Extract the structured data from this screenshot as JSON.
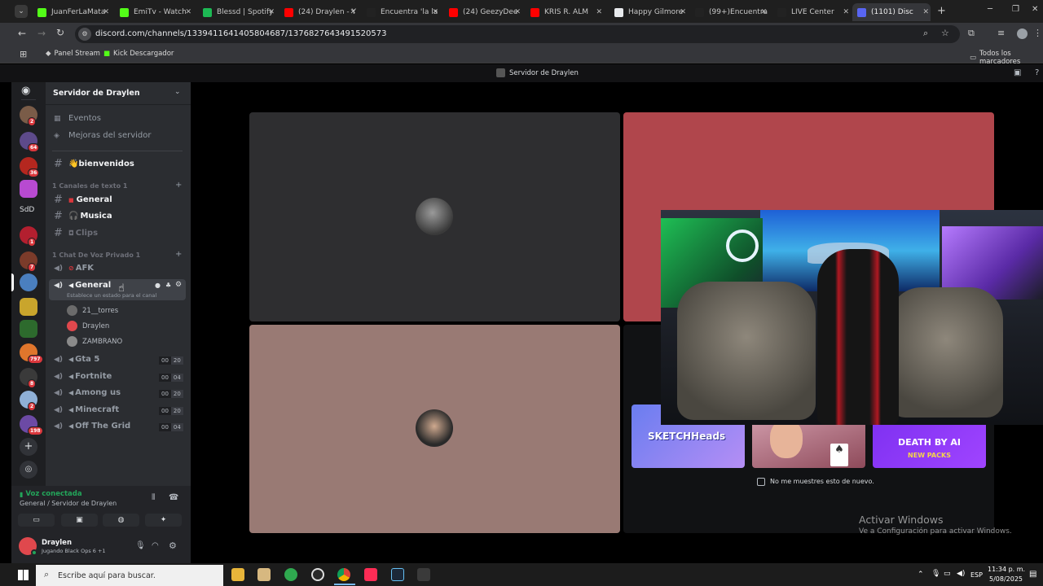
{
  "browser": {
    "tabs": [
      {
        "label": "JuanFerLaMata",
        "color": "#53fc18"
      },
      {
        "label": "EmiTv - Watch",
        "color": "#53fc18"
      },
      {
        "label": "Blessd | Spotify",
        "color": "#1db954"
      },
      {
        "label": "(24) Draylen - Y",
        "color": "#ff0000"
      },
      {
        "label": "Encuentra 'la la",
        "color": "#222222"
      },
      {
        "label": "(24) GeezyDee",
        "color": "#ff0000"
      },
      {
        "label": "KRIS R. ALM",
        "color": "#ff0000"
      },
      {
        "label": "Happy Gilmore",
        "color": "#e8eaed"
      },
      {
        "label": "(99+)Encuentra",
        "color": "#222222"
      },
      {
        "label": "LIVE Center",
        "color": "#222222"
      },
      {
        "label": "(1101) Disc",
        "color": "#5865f2"
      }
    ],
    "url": "discord.com/channels/1339411641405804687/1376827643491520573",
    "bookmarks": [
      "Panel Stream",
      "Kick Descargador"
    ],
    "other_bookmarks": "Todos los marcadores"
  },
  "discord": {
    "window_title": "Servidor de Draylen",
    "server_name": "Servidor de Draylen",
    "guild_badges": [
      "2",
      "64",
      "36",
      "1",
      "7",
      "797",
      "8",
      "2",
      "198"
    ],
    "guild_text": "SdD",
    "menu": {
      "events": "Eventos",
      "boosts": "Mejoras del servidor"
    },
    "welcome": "👋bienvenidos",
    "text_category": "1 Canales de texto 1",
    "text_channels": [
      "General",
      "Musica",
      "Clips"
    ],
    "voice_category": "1 Chat De Voz Privado 1",
    "afk": "AFK",
    "active_voice": {
      "name": "General",
      "status": "Establece un estado para el canal"
    },
    "voice_users": [
      "21__torres",
      "Draylen",
      "ZAMBRANO"
    ],
    "voice_channels": [
      {
        "name": "Gta 5",
        "count": "00",
        "limit": "20"
      },
      {
        "name": "Fortnite",
        "count": "00",
        "limit": "04"
      },
      {
        "name": "Among us",
        "count": "00",
        "limit": "20"
      },
      {
        "name": "Minecraft",
        "count": "00",
        "limit": "20"
      },
      {
        "name": "Off The Grid",
        "count": "00",
        "limit": "04"
      }
    ],
    "voice_connected": "Voz conectada",
    "voice_location": "General / Servidor de Draylen",
    "user": {
      "name": "Draylen",
      "activity": "Jugando Black Ops 6 +1"
    },
    "activities": [
      "SKETCHHeads",
      "DEATH BY AI",
      "NEW PACKS"
    ],
    "dont_show": "No me muestres esto de nuevo."
  },
  "windows": {
    "activate_title": "Activar Windows",
    "activate_sub": "Ve a Configuración para activar Windows.",
    "search_placeholder": "Escribe aquí para buscar.",
    "lang": "ESP",
    "time": "11:34 p. m.",
    "date": "5/08/2025"
  }
}
